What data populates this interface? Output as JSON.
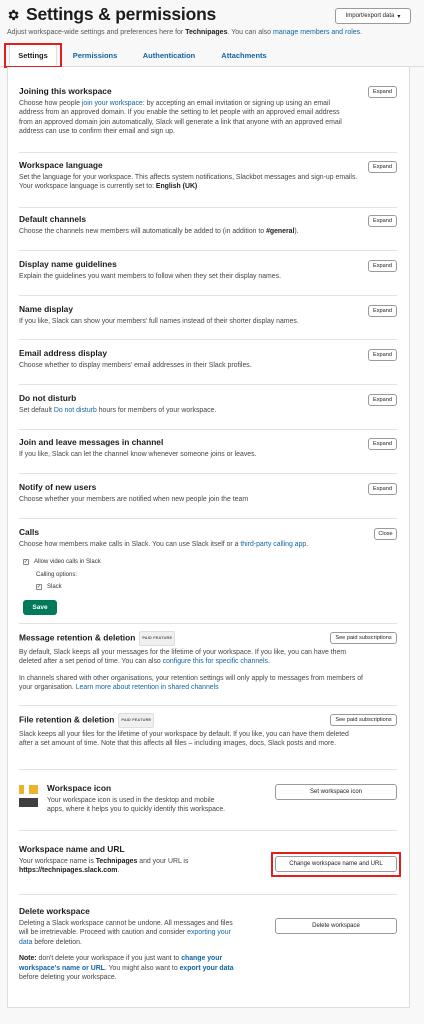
{
  "header": {
    "title": "Settings & permissions",
    "import_button": "Import/export data",
    "subtitle_pre": "Adjust workspace-wide settings and preferences here for ",
    "workspace_bold": "Technipages",
    "subtitle_mid": ". You can also ",
    "subtitle_link": "manage members and roles."
  },
  "tabs": [
    {
      "label": "Settings",
      "active": true
    },
    {
      "label": "Permissions"
    },
    {
      "label": "Authentication"
    },
    {
      "label": "Attachments"
    }
  ],
  "expand_label": "Expand",
  "close_label": "Close",
  "sections": {
    "joining": {
      "title": "Joining this workspace",
      "desc_pre": "Choose how people ",
      "desc_link": "join your workspace",
      "desc_post": ": by accepting an email invitation or signing up using an email address from an approved domain. If you enable the setting to let people with an approved email address from an approved domain join automatically, Slack will generate a link that anyone with an approved email address can use to confirm their email and sign up."
    },
    "language": {
      "title": "Workspace language",
      "desc": "Set the language for your workspace. This affects system notifications, Slackbot messages and sign-up emails. Your workspace language is currently set to: ",
      "desc_bold": "English (UK)"
    },
    "channels": {
      "title": "Default channels",
      "desc": "Choose the channels new members will automatically be added to (in addition to ",
      "desc_bold": "#general",
      "desc_end": ")."
    },
    "display_guidelines": {
      "title": "Display name guidelines",
      "desc": "Explain the guidelines you want members to follow when they set their display names."
    },
    "name_display": {
      "title": "Name display",
      "desc": "If you like, Slack can show your members' full names instead of their shorter display names."
    },
    "email_display": {
      "title": "Email address display",
      "desc": "Choose whether to display members' email addresses in their Slack profiles."
    },
    "dnd": {
      "title": "Do not disturb",
      "desc_pre": "Set default ",
      "desc_link": "Do not disturb",
      "desc_post": " hours for members of your workspace."
    },
    "join_leave": {
      "title": "Join and leave messages in channel",
      "desc": "If you like, Slack can let the channel know whenever someone joins or leaves."
    },
    "notify_users": {
      "title": "Notify of new users",
      "desc": "Choose whether your members are notified when new people join the team"
    },
    "calls": {
      "title": "Calls",
      "desc_pre": "Choose how members make calls in Slack. You can use Slack itself or a ",
      "desc_link": "third-party calling app",
      "desc_post": ".",
      "allow_video": "Allow video calls in Slack",
      "calling_options": "Calling options:",
      "slack_option": "Slack",
      "save": "Save"
    },
    "message_retention": {
      "title": "Message retention & deletion",
      "badge": "PAID FEATURE",
      "button": "See paid subscriptions",
      "desc1_pre": "By default, Slack keeps all your messages for the lifetime of your workspace. If you like, you can have them deleted after a set period of time. You can also ",
      "desc1_link": "configure this for specific channels",
      "desc1_post": ".",
      "desc2_pre": "In channels shared with other organisations, your retention settings will only apply to messages from members of your organisation. ",
      "desc2_link": "Learn more about retention in shared channels"
    },
    "file_retention": {
      "title": "File retention & deletion",
      "badge": "PAID FEATURE",
      "button": "See paid subscriptions",
      "desc": "Slack keeps all your files for the lifetime of your workspace by default. If you like, you can have them deleted after a set amount of time. Note that this affects all files – including images, docs, Slack posts and more."
    },
    "workspace_icon": {
      "title": "Workspace icon",
      "desc": "Your workspace icon is used in the desktop and mobile apps, where it helps you to quickly identify this workspace.",
      "button": "Set workspace icon",
      "icon": "workspace-logo-icon",
      "logo_colors": [
        "#ecb22e",
        "#3f3f3f"
      ]
    },
    "name_url": {
      "title": "Workspace name and URL",
      "desc_pre": "Your workspace name is ",
      "desc_bold1": "Technipages",
      "desc_mid": " and your URL is ",
      "desc_bold2": "https://technipages.slack.com",
      "desc_end": ".",
      "button": "Change workspace name and URL"
    },
    "delete": {
      "title": "Delete workspace",
      "desc_pre": "Deleting a Slack workspace cannot be undone. All messages and files will be irretrievable. Proceed with caution and consider ",
      "desc_link": "exporting your data",
      "desc_post": " before deletion.",
      "note_label": "Note:",
      "note_pre": " don't delete your workspace if you just want to ",
      "note_link1": "change your workspace's name or URL",
      "note_mid": ". You might also want to ",
      "note_link2": "export your data",
      "note_post": " before deleting your workspace.",
      "button": "Delete workspace"
    }
  },
  "colors": {
    "accent_link": "#1264a3",
    "save_green": "#007a5a",
    "highlight_red": "#e01e1e"
  }
}
